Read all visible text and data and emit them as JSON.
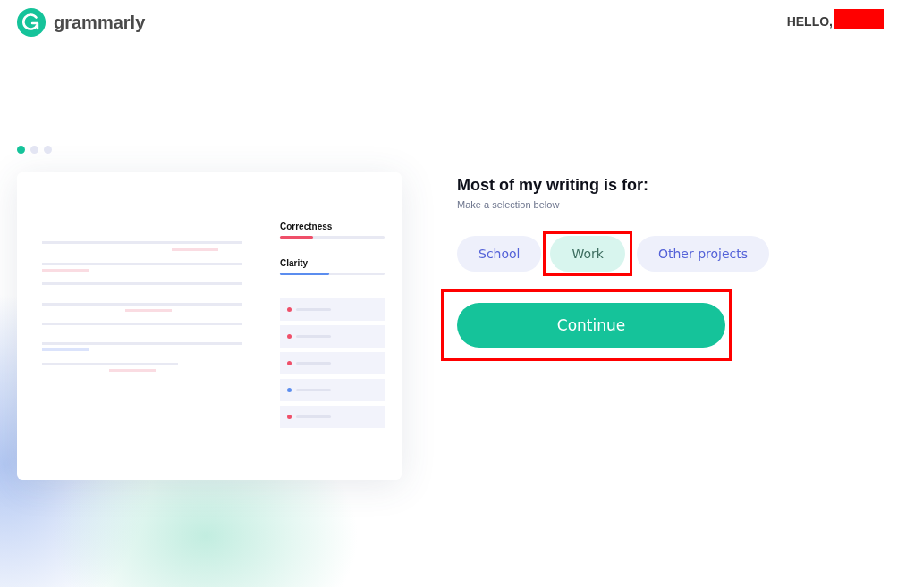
{
  "header": {
    "logo_text": "grammarly",
    "greeting": "HELLO,"
  },
  "carousel": [
    {
      "selected": true
    },
    {
      "selected": false
    },
    {
      "selected": false
    }
  ],
  "preview": {
    "scores": [
      {
        "label": "Correctness",
        "level": 0.32,
        "color": "#ef4f69"
      },
      {
        "label": "Clarity",
        "level": 0.47,
        "color": "#5b8def"
      }
    ],
    "issues": [
      {
        "color": "#ef4f69"
      },
      {
        "color": "#ef4f69"
      },
      {
        "color": "#ef4f69"
      },
      {
        "color": "#5b8def"
      },
      {
        "color": "#ef4f69"
      }
    ]
  },
  "question": {
    "title": "Most of my writing is for:",
    "subtitle": "Make a selection below"
  },
  "options": [
    {
      "label": "School",
      "selected": false,
      "highlighted": false
    },
    {
      "label": "Work",
      "selected": true,
      "highlighted": true
    },
    {
      "label": "Other projects",
      "selected": false,
      "highlighted": false
    }
  ],
  "continue_button": {
    "label": "Continue",
    "highlighted": true
  }
}
